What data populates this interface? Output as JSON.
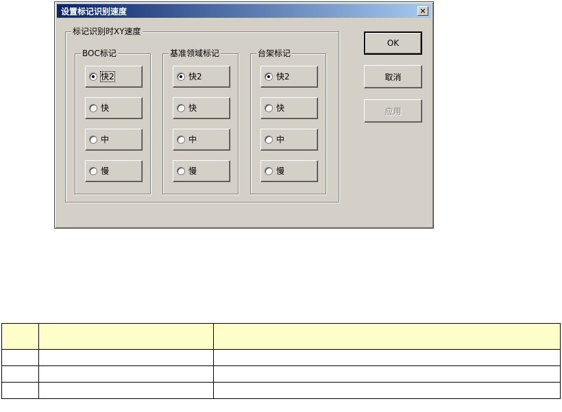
{
  "dialog": {
    "title": "设置标记识别速度",
    "close_glyph": "✕",
    "group_title": "标记识别时XY速度",
    "columns": [
      {
        "title": "BOC标记",
        "options": [
          "快2",
          "快",
          "中",
          "慢"
        ],
        "selected": 0
      },
      {
        "title": "基准领域标记",
        "options": [
          "快2",
          "快",
          "中",
          "慢"
        ],
        "selected": 0
      },
      {
        "title": "台架标记",
        "options": [
          "快2",
          "快",
          "中",
          "慢"
        ],
        "selected": 0
      }
    ],
    "buttons": {
      "ok": "OK",
      "cancel": "取消",
      "apply": "应用"
    }
  },
  "table": {
    "headers": [
      "",
      "",
      ""
    ],
    "rows": [
      [
        "",
        "",
        ""
      ],
      [
        "",
        "",
        ""
      ],
      [
        "",
        "",
        ""
      ]
    ]
  }
}
